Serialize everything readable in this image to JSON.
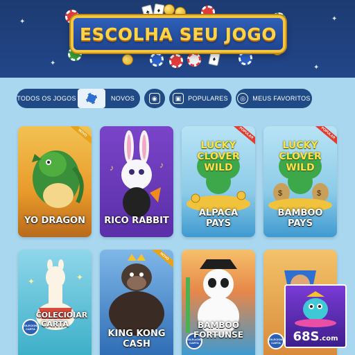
{
  "header": {
    "title": "ESCOLHA SEU JOGO"
  },
  "filters": {
    "all_games": "TODOS OS JOGOS",
    "new": "NOVOS",
    "popular": "POPULARES",
    "favorites": "MEUS FAVORITOS"
  },
  "games": [
    {
      "title": "YO DRAGON",
      "tag": "NOVO"
    },
    {
      "title": "RICO RABBIT",
      "tag": ""
    },
    {
      "title_line1": "ALPACA",
      "title_line2": "PAYS",
      "art_line1": "LUCKY",
      "art_line2": "CLOVER",
      "art_line3": "WILD",
      "tag": "POPULAR"
    },
    {
      "title_line1": "BAMBOO",
      "title_line2": "PAYS",
      "art_line1": "LUCKY",
      "art_line2": "CLOVER",
      "art_line3": "WILD",
      "tag": "POPULAR"
    },
    {
      "title_line1": "COLECIOIAR",
      "title_line2": "CARTA",
      "badge": "COLECIONE CARTA",
      "tag": ""
    },
    {
      "title_line1": "KING KONG",
      "title_line2": "CASH",
      "tag": "NOVO"
    },
    {
      "title_line1": "BAMBOO",
      "title_line2": "FORTUNSE",
      "badge": "COLECIONE CARTA",
      "tag": ""
    },
    {
      "title": "",
      "badge": "COLECIONE CARTA",
      "tag": ""
    }
  ],
  "brand": {
    "logo_text": "68S",
    "logo_suffix": ".com"
  },
  "colors": {
    "header_bg": "#1d3b72",
    "page_bg": "#a9d7ef",
    "pill_bg": "#204a86",
    "title_gold": "#ffd347"
  }
}
